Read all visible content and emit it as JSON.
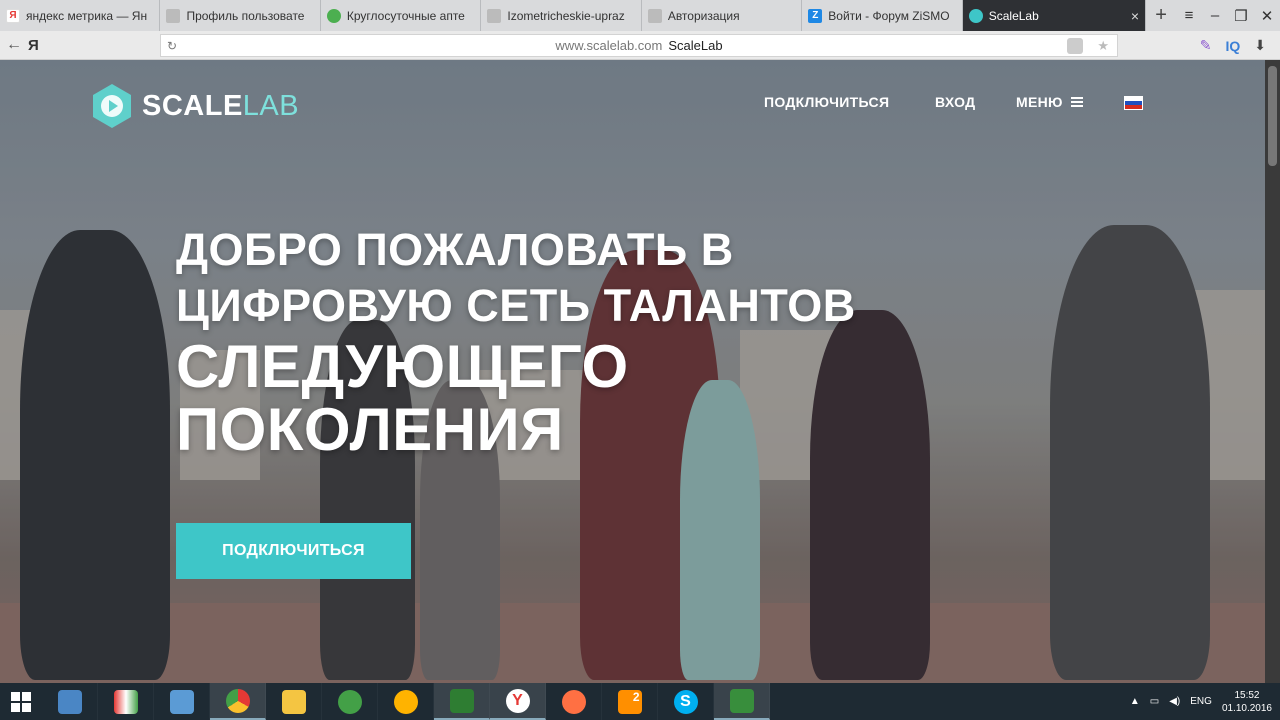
{
  "browser": {
    "tabs": [
      {
        "title": "яндекс метрика — Ян",
        "favicon_color": "#e53935",
        "favicon_letter": "Я"
      },
      {
        "title": "Профиль пользовате",
        "favicon_color": "#aaaaaa",
        "favicon_letter": ""
      },
      {
        "title": "Круглосуточные апте",
        "favicon_color": "#4caf50",
        "favicon_letter": ""
      },
      {
        "title": "Izometricheskie-upraz",
        "favicon_color": "#aaaaaa",
        "favicon_letter": ""
      },
      {
        "title": "Авторизация",
        "favicon_color": "#aaaaaa",
        "favicon_letter": ""
      },
      {
        "title": "Войти - Форум ZiSMO",
        "favicon_color": "#1e88e5",
        "favicon_letter": "Z"
      }
    ],
    "active_tab": {
      "title": "ScaleLab",
      "favicon_color": "#2e3034",
      "close": "×"
    },
    "new_tab": "+",
    "back": "←",
    "yandex_button": "Я",
    "address": {
      "domain": "www.scalelab.com",
      "page_title": "ScaleLab"
    }
  },
  "site": {
    "logo": {
      "part1": "SCALE",
      "part2": "LAB"
    },
    "nav": {
      "connect": "ПОДКЛЮЧИТЬСЯ",
      "login": "ВХОД",
      "menu": "МЕНЮ"
    },
    "hero": {
      "line1": "ДОБРО ПОЖАЛОВАТЬ В",
      "line2": "ЦИФРОВУЮ СЕТЬ ТАЛАНТОВ",
      "line3": "СЛЕДУЮЩЕГО",
      "line4": "ПОКОЛЕНИЯ"
    },
    "cta": "ПОДКЛЮЧИТЬСЯ",
    "accent": "#3ec6c8"
  },
  "taskbar": {
    "apps": [
      {
        "icon": "computer-icon",
        "color": "#4a86c5"
      },
      {
        "icon": "rainbow-app-icon",
        "color": "#e53935"
      },
      {
        "icon": "control-panel-icon",
        "color": "#5b9bd5"
      },
      {
        "icon": "chrome-icon",
        "color": "#fbc02d"
      },
      {
        "icon": "folder-icon",
        "color": "#f4c542"
      },
      {
        "icon": "shield-app-icon",
        "color": "#43a047"
      },
      {
        "icon": "headphones-icon",
        "color": "#ffb300"
      },
      {
        "icon": "camtasia-icon",
        "color": "#2e7d32"
      },
      {
        "icon": "yandex-browser-icon",
        "color": "#e53935"
      },
      {
        "icon": "firefox-icon",
        "color": "#ff7043"
      },
      {
        "icon": "files-badge-icon",
        "color": "#ff8f00",
        "badge": "2"
      },
      {
        "icon": "skype-icon",
        "color": "#00aff0"
      },
      {
        "icon": "camtasia-recorder-icon",
        "color": "#388e3c"
      }
    ],
    "lang": "ENG",
    "time": "15:52",
    "date": "01.10.2016"
  }
}
